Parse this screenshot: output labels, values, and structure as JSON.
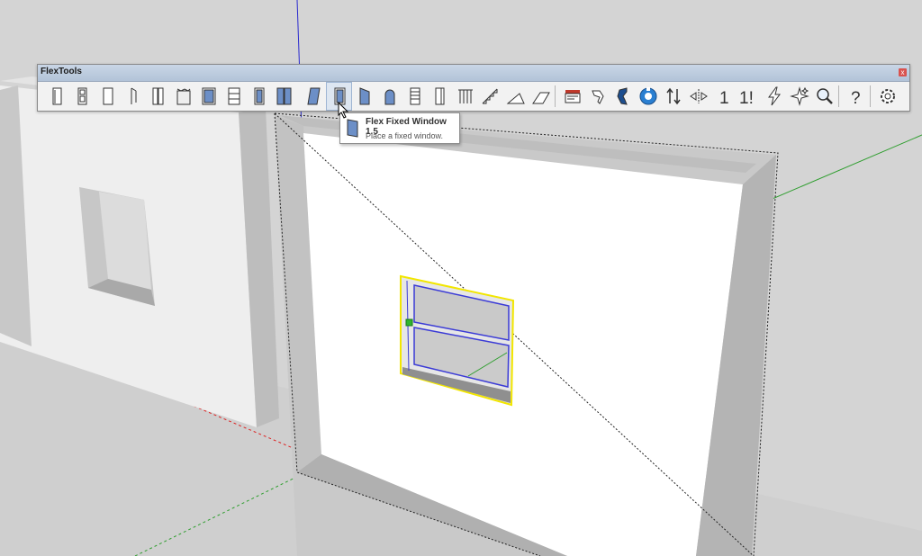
{
  "toolbar": {
    "title": "FlexTools",
    "close_label": "x",
    "tools": [
      {
        "name": "door-icon"
      },
      {
        "name": "door-panel-icon"
      },
      {
        "name": "door-plain-icon"
      },
      {
        "name": "door-swing-icon"
      },
      {
        "name": "double-door-icon"
      },
      {
        "name": "bifold-door-icon"
      },
      {
        "name": "sliding-door-icon"
      },
      {
        "name": "pocket-door-icon"
      },
      {
        "name": "french-door-icon"
      },
      {
        "name": "garage-door-icon"
      },
      {
        "name": "casement-window-icon"
      },
      {
        "name": "fixed-window-icon"
      },
      {
        "name": "awning-window-icon"
      },
      {
        "name": "arch-window-icon"
      },
      {
        "name": "louver-window-icon"
      },
      {
        "name": "opening-icon"
      },
      {
        "name": "railing-icon"
      },
      {
        "name": "stair-icon"
      },
      {
        "name": "ramp-icon"
      },
      {
        "name": "wedge-icon"
      },
      {
        "name": "presentation-icon"
      },
      {
        "name": "paint-icon"
      },
      {
        "name": "wall-cutter-icon"
      },
      {
        "name": "rotate-icon"
      },
      {
        "name": "flip-vertical-icon"
      },
      {
        "name": "flip-horizontal-icon"
      },
      {
        "name": "one-icon"
      },
      {
        "name": "one-bang-icon"
      },
      {
        "name": "lightning-icon"
      },
      {
        "name": "sparkle-icon"
      },
      {
        "name": "zoom-icon"
      },
      {
        "name": "help-icon"
      },
      {
        "name": "settings-icon"
      }
    ],
    "digit_label": "1",
    "digit_bang_label": "1!",
    "help_label": "?"
  },
  "tooltip": {
    "title": "Flex Fixed Window 1.5",
    "description": "Place a fixed window."
  },
  "colors": {
    "toolbar_bg": "#f2f2f2",
    "titlebar": "#b8c8dc",
    "selection_yellow": "#f2e600",
    "glass_blue": "#3b3bd6",
    "axis_green": "#2e9e2e",
    "axis_red": "#d22",
    "axis_blue": "#2a2acf"
  }
}
